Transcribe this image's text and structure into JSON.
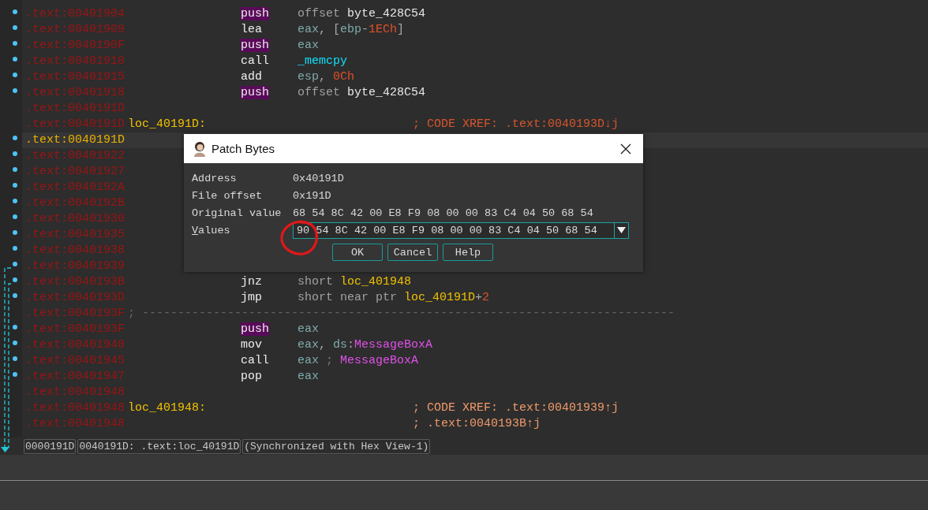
{
  "listing": {
    "rows": [
      {
        "address": ".text:00401904",
        "dot": true,
        "mnemonic": "push",
        "highlighted": true,
        "operand": [
          {
            "text": "offset ",
            "kind": "keyword"
          },
          {
            "text": "byte_428C54",
            "kind": "name"
          }
        ]
      },
      {
        "address": ".text:00401909",
        "dot": true,
        "mnemonic": "lea",
        "highlighted": false,
        "operand": [
          {
            "text": "eax",
            "kind": "reg"
          },
          {
            "text": ", [",
            "kind": "punct"
          },
          {
            "text": "ebp",
            "kind": "reg"
          },
          {
            "text": "-",
            "kind": "punct"
          },
          {
            "text": "1ECh",
            "kind": "number"
          },
          {
            "text": "]",
            "kind": "punct"
          }
        ]
      },
      {
        "address": ".text:0040190F",
        "dot": true,
        "mnemonic": "push",
        "highlighted": true,
        "operand": [
          {
            "text": "eax",
            "kind": "reg"
          }
        ]
      },
      {
        "address": ".text:00401910",
        "dot": true,
        "mnemonic": "call",
        "highlighted": false,
        "operand": [
          {
            "text": "_memcpy",
            "kind": "func"
          }
        ]
      },
      {
        "address": ".text:00401915",
        "dot": true,
        "mnemonic": "add",
        "highlighted": false,
        "operand": [
          {
            "text": "esp",
            "kind": "reg"
          },
          {
            "text": ", ",
            "kind": "punct"
          },
          {
            "text": "0Ch",
            "kind": "number"
          }
        ]
      },
      {
        "address": ".text:00401918",
        "dot": true,
        "mnemonic": "push",
        "highlighted": true,
        "operand": [
          {
            "text": "offset ",
            "kind": "keyword"
          },
          {
            "text": "byte_428C54",
            "kind": "name"
          }
        ]
      },
      {
        "address": ".text:0040191D",
        "dot": false
      },
      {
        "address": ".text:0040191D",
        "dot": false,
        "label": "loc_40191D:",
        "comment": [
          {
            "text": "; CODE XREF: .text:0040193D↓j",
            "kind": "xref"
          }
        ]
      },
      {
        "address": ".text:0040191D",
        "dot": true,
        "selected": true
      },
      {
        "address": ".text:00401922",
        "dot": true
      },
      {
        "address": ".text:00401927",
        "dot": true
      },
      {
        "address": ".text:0040192A",
        "dot": true
      },
      {
        "address": ".text:0040192B",
        "dot": true
      },
      {
        "address": ".text:00401930",
        "dot": true
      },
      {
        "address": ".text:00401935",
        "dot": true
      },
      {
        "address": ".text:00401938",
        "dot": true
      },
      {
        "address": ".text:00401939",
        "dot": true
      },
      {
        "address": ".text:0040193B",
        "dot": true,
        "mnemonic": "jnz",
        "highlighted": false,
        "operand": [
          {
            "text": "short ",
            "kind": "keyword"
          },
          {
            "text": "loc_401948",
            "kind": "label"
          }
        ]
      },
      {
        "address": ".text:0040193D",
        "dot": true,
        "mnemonic": "jmp",
        "highlighted": false,
        "operand": [
          {
            "text": "short near ptr ",
            "kind": "keyword"
          },
          {
            "text": "loc_40191D",
            "kind": "label"
          },
          {
            "text": "+",
            "kind": "punct"
          },
          {
            "text": "2",
            "kind": "number"
          }
        ]
      },
      {
        "address": ".text:0040193F",
        "dot": false,
        "separator": "; ---------------------------------------------------------------------------"
      },
      {
        "address": ".text:0040193F",
        "dot": true,
        "mnemonic": "push",
        "highlighted": true,
        "operand": [
          {
            "text": "eax",
            "kind": "reg"
          }
        ]
      },
      {
        "address": ".text:00401940",
        "dot": true,
        "mnemonic": "mov",
        "highlighted": false,
        "operand": [
          {
            "text": "eax",
            "kind": "reg"
          },
          {
            "text": ", ",
            "kind": "punct"
          },
          {
            "text": "ds",
            "kind": "reg"
          },
          {
            "text": ":",
            "kind": "punct"
          },
          {
            "text": "MessageBoxA",
            "kind": "import"
          }
        ]
      },
      {
        "address": ".text:00401945",
        "dot": true,
        "mnemonic": "call",
        "highlighted": false,
        "operand": [
          {
            "text": "eax",
            "kind": "reg"
          },
          {
            "text": " ; ",
            "kind": "sep"
          },
          {
            "text": "MessageBoxA",
            "kind": "import"
          }
        ]
      },
      {
        "address": ".text:00401947",
        "dot": true,
        "mnemonic": "pop",
        "highlighted": false,
        "operand": [
          {
            "text": "eax",
            "kind": "reg"
          }
        ]
      },
      {
        "address": ".text:00401948",
        "dot": false
      },
      {
        "address": ".text:00401948",
        "dot": false,
        "label": "loc_401948:",
        "comment": [
          {
            "text": "; CODE XREF: .text:00401939↑j",
            "kind": "ref"
          }
        ]
      },
      {
        "address": ".text:00401948",
        "dot": false,
        "comment": [
          {
            "text": "; .text:0040193B↑j",
            "kind": "ref"
          }
        ]
      }
    ]
  },
  "status_bar": [
    "0000191D",
    "0040191D: .text:loc_40191D",
    "(Synchronized with Hex View-1)"
  ],
  "dialog": {
    "title": "Patch Bytes",
    "fields": [
      {
        "label": "Address",
        "value": "0x40191D",
        "kind": "text"
      },
      {
        "label": "File offset",
        "value": "0x191D",
        "kind": "text"
      },
      {
        "label": "Original value",
        "value": "68 54 8C 42 00 E8 F9 08 00 00 83 C4 04 50 68 54",
        "kind": "text"
      },
      {
        "label": "Values",
        "value": "90 54 8C 42 00 E8 F9 08 00 00 83 C4 04 50 68 54",
        "kind": "combo",
        "access_key": true
      }
    ],
    "buttons": [
      "OK",
      "Cancel",
      "Help"
    ],
    "annotation": {
      "kind": "circle"
    }
  }
}
